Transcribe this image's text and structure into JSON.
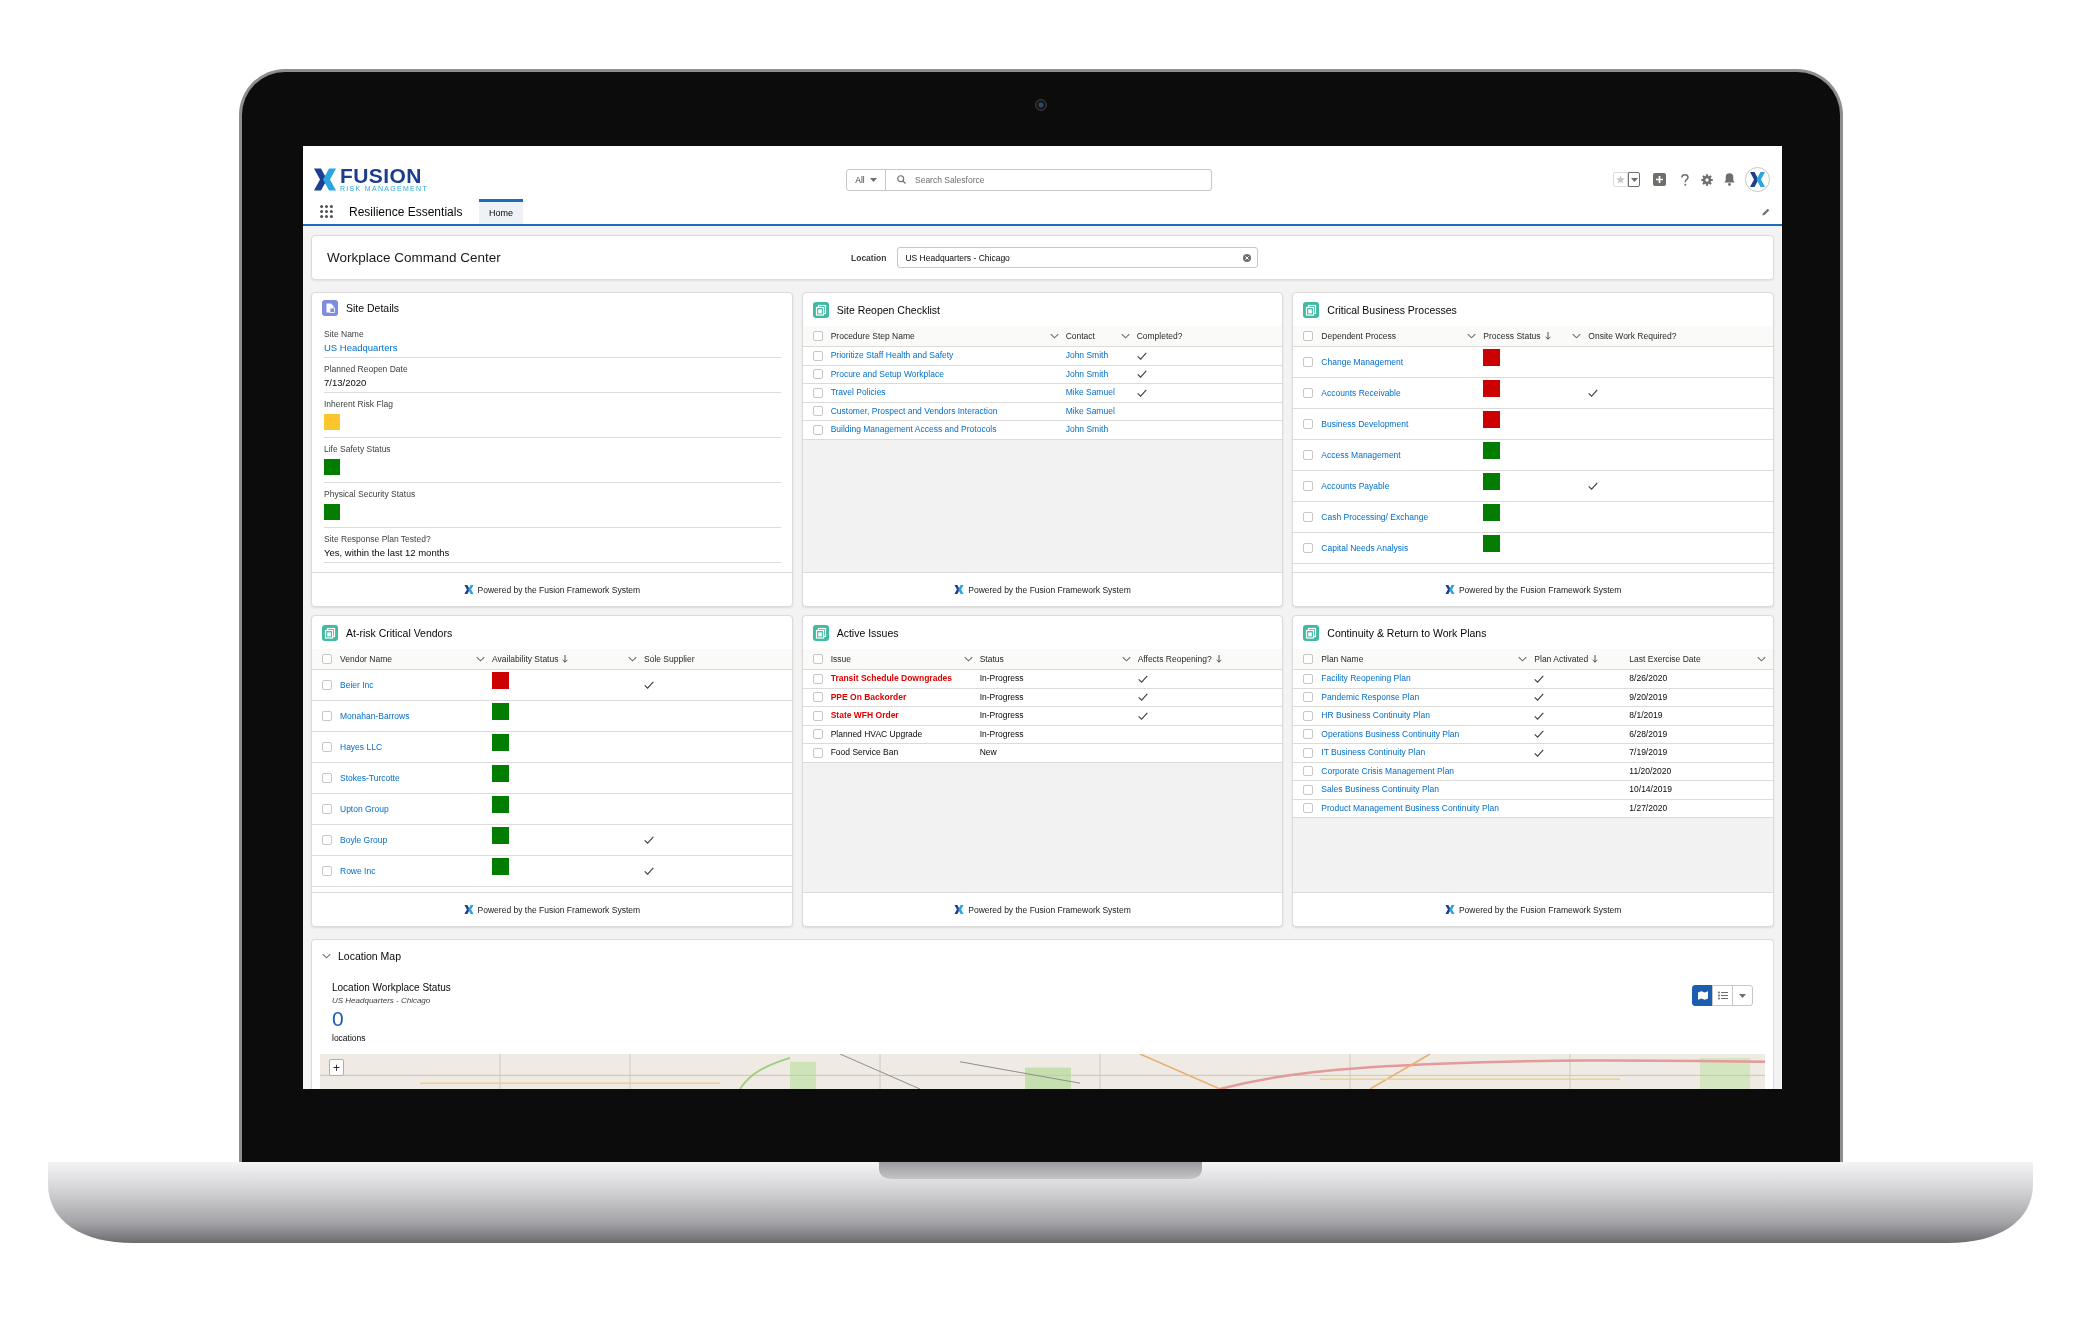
{
  "header": {
    "logo": {
      "name": "FUSION",
      "tagline": "RISK MANAGEMENT"
    },
    "search": {
      "scope": "All",
      "placeholder": "Search Salesforce"
    },
    "app_name": "Resilience Essentials",
    "tabs": [
      {
        "label": "Home",
        "selected": true
      }
    ]
  },
  "page_header": {
    "title": "Workplace Command Center",
    "location_label": "Location",
    "location_value": "US Headquarters - Chicago"
  },
  "cards": [
    {
      "kind": "details",
      "title": "Site Details",
      "fields": [
        {
          "label": "Site Name",
          "kind": "link",
          "value": "US Headquarters"
        },
        {
          "label": "Planned Reopen Date",
          "kind": "text",
          "value": "7/13/2020"
        },
        {
          "label": "Inherent Risk Flag",
          "kind": "flag",
          "color": "#fcc52d"
        },
        {
          "label": "Life Safety Status",
          "kind": "flag",
          "color": "#027d02"
        },
        {
          "label": "Physical Security Status",
          "kind": "flag",
          "color": "#027d02"
        },
        {
          "label": "Site Response Plan Tested?",
          "kind": "text",
          "value": "Yes, within the last 12 months"
        }
      ],
      "footer": "Powered by the Fusion Framework System"
    },
    {
      "kind": "table",
      "title": "Site Reopen Checklist",
      "all_checked": false,
      "columns": [
        {
          "label": "Procedure Step Name",
          "kind": "link",
          "sorted": false,
          "menu": true
        },
        {
          "label": "Contact",
          "kind": "link",
          "sorted": false,
          "menu": true
        },
        {
          "label": "Completed?",
          "kind": "check",
          "sorted": false,
          "menu": false
        }
      ],
      "rows": [
        {
          "checked": false,
          "cells": [
            "Prioritize Staff Health and Safety",
            "John Smith",
            {
              "checked": true
            }
          ]
        },
        {
          "checked": false,
          "cells": [
            "Procure and Setup Workplace",
            "John Smith",
            {
              "checked": true
            }
          ]
        },
        {
          "checked": false,
          "cells": [
            "Travel Policies",
            "Mike Samuel",
            {
              "checked": true
            }
          ]
        },
        {
          "checked": false,
          "cells": [
            "Customer, Prospect and Vendors Interaction",
            "Mike Samuel",
            {
              "checked": false
            }
          ]
        },
        {
          "checked": false,
          "cells": [
            "Building Management Access and Protocols",
            "John Smith",
            {
              "checked": false
            }
          ]
        }
      ],
      "footer": "Powered by the Fusion Framework System"
    },
    {
      "kind": "table",
      "title": "Critical Business Processes",
      "all_checked": false,
      "columns": [
        {
          "label": "Dependent Process",
          "kind": "link",
          "sorted": false,
          "menu": true
        },
        {
          "label": "Process Status",
          "kind": "status",
          "sorted": true,
          "menu": true
        },
        {
          "label": "Onsite Work Required?",
          "kind": "check",
          "sorted": false,
          "menu": false
        }
      ],
      "rows": [
        {
          "checked": false,
          "cells": [
            "Change Management",
            {
              "color": "#cc0000"
            },
            {
              "checked": false
            }
          ]
        },
        {
          "checked": false,
          "cells": [
            "Accounts Receivable",
            {
              "color": "#cc0000"
            },
            {
              "checked": true
            }
          ]
        },
        {
          "checked": false,
          "cells": [
            "Business Development",
            {
              "color": "#cc0000"
            },
            {
              "checked": false
            }
          ]
        },
        {
          "checked": false,
          "cells": [
            "Access Management",
            {
              "color": "#027d02"
            },
            {
              "checked": false
            }
          ]
        },
        {
          "checked": false,
          "cells": [
            "Accounts Payable",
            {
              "color": "#027d02"
            },
            {
              "checked": true
            }
          ]
        },
        {
          "checked": false,
          "cells": [
            "Cash Processing/ Exchange",
            {
              "color": "#027d02"
            },
            {
              "checked": false
            }
          ]
        },
        {
          "checked": false,
          "cells": [
            "Capital Needs Analysis",
            {
              "color": "#027d02"
            },
            {
              "checked": false
            }
          ]
        }
      ],
      "footer": "Powered by the Fusion Framework System"
    },
    {
      "kind": "table",
      "title": "At-risk Critical Vendors",
      "all_checked": false,
      "columns": [
        {
          "label": "Vendor Name",
          "kind": "link",
          "sorted": false,
          "menu": true
        },
        {
          "label": "Availability Status",
          "kind": "status",
          "sorted": true,
          "menu": true
        },
        {
          "label": "Sole Supplier",
          "kind": "check",
          "sorted": false,
          "menu": false
        }
      ],
      "rows": [
        {
          "checked": false,
          "cells": [
            "Beier Inc",
            {
              "color": "#cc0000"
            },
            {
              "checked": true
            }
          ]
        },
        {
          "checked": false,
          "cells": [
            "Monahan-Barrows",
            {
              "color": "#027d02"
            },
            {
              "checked": false
            }
          ]
        },
        {
          "checked": false,
          "cells": [
            "Hayes LLC",
            {
              "color": "#027d02"
            },
            {
              "checked": false
            }
          ]
        },
        {
          "checked": false,
          "cells": [
            "Stokes-Turcotte",
            {
              "color": "#027d02"
            },
            {
              "checked": false
            }
          ]
        },
        {
          "checked": false,
          "cells": [
            "Upton Group",
            {
              "color": "#027d02"
            },
            {
              "checked": false
            }
          ]
        },
        {
          "checked": false,
          "cells": [
            "Boyle Group",
            {
              "color": "#027d02"
            },
            {
              "checked": true
            }
          ]
        },
        {
          "checked": false,
          "cells": [
            "Rowe Inc",
            {
              "color": "#027d02"
            },
            {
              "checked": true
            }
          ]
        }
      ],
      "footer": "Powered by the Fusion Framework System"
    },
    {
      "kind": "table",
      "title": "Active Issues",
      "all_checked": false,
      "columns": [
        {
          "label": "Issue",
          "kind": "issue",
          "sorted": false,
          "menu": true
        },
        {
          "label": "Status",
          "kind": "text",
          "sorted": false,
          "menu": true
        },
        {
          "label": "Affects Reopening?",
          "kind": "check",
          "sorted": true,
          "menu": false
        }
      ],
      "rows": [
        {
          "checked": false,
          "highlighted": true,
          "cells": [
            "Transit Schedule Downgrades",
            "In-Progress",
            {
              "checked": true
            }
          ]
        },
        {
          "checked": false,
          "highlighted": true,
          "cells": [
            "PPE On Backorder",
            "In-Progress",
            {
              "checked": true
            }
          ]
        },
        {
          "checked": false,
          "highlighted": true,
          "cells": [
            "State WFH Order",
            "In-Progress",
            {
              "checked": true
            }
          ]
        },
        {
          "checked": false,
          "highlighted": false,
          "cells": [
            "Planned HVAC Upgrade",
            "In-Progress",
            {
              "checked": false
            }
          ]
        },
        {
          "checked": false,
          "highlighted": false,
          "cells": [
            "Food Service Ban",
            "New",
            {
              "checked": false
            }
          ]
        }
      ],
      "footer": "Powered by the Fusion Framework System"
    },
    {
      "kind": "table",
      "title": "Continuity & Return to Work Plans",
      "all_checked": false,
      "columns": [
        {
          "label": "Plan Name",
          "kind": "link",
          "sorted": false,
          "menu": true
        },
        {
          "label": "Plan Activated",
          "kind": "check",
          "sorted": true,
          "menu": false
        },
        {
          "label": "Last Exercise Date",
          "kind": "date",
          "sorted": false,
          "menu": true
        }
      ],
      "rows": [
        {
          "checked": false,
          "cells": [
            "Facility Reopening Plan",
            {
              "checked": true
            },
            "8/26/2020"
          ]
        },
        {
          "checked": false,
          "cells": [
            "Pandemic Response Plan",
            {
              "checked": true
            },
            "9/20/2019"
          ]
        },
        {
          "checked": false,
          "cells": [
            "HR Business Continuity Plan",
            {
              "checked": true
            },
            "8/1/2019"
          ]
        },
        {
          "checked": false,
          "cells": [
            "Operations Business Continuity Plan",
            {
              "checked": true
            },
            "6/28/2019"
          ]
        },
        {
          "checked": false,
          "cells": [
            "IT Business Continuity Plan",
            {
              "checked": true
            },
            "7/19/2019"
          ]
        },
        {
          "checked": false,
          "cells": [
            "Corporate Crisis Management Plan",
            {
              "checked": false
            },
            "11/20/2020"
          ]
        },
        {
          "checked": false,
          "cells": [
            "Sales Business Continuity Plan",
            {
              "checked": false
            },
            "10/14/2019"
          ]
        },
        {
          "checked": false,
          "cells": [
            "Product Management Business Continuity Plan",
            {
              "checked": false
            },
            "1/27/2020"
          ]
        }
      ],
      "footer": "Powered by the Fusion Framework System"
    }
  ],
  "location_map": {
    "title": "Location Map",
    "expanded": true,
    "heading": "Location Workplace Status",
    "subtitle": "US Headquarters - Chicago",
    "count": "0",
    "count_label": "locations",
    "views": [
      {
        "kind": "map",
        "selected": true
      },
      {
        "kind": "list",
        "selected": false
      }
    ],
    "zoom_in": "+"
  }
}
